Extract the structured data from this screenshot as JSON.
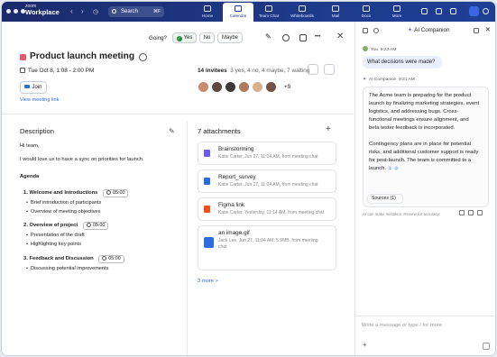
{
  "topbar": {
    "brand_small": "zoom",
    "brand_big": "Workplace",
    "search_label": "Search",
    "search_shortcut": "⌘F",
    "tabs": [
      {
        "label": "Home",
        "icon": "home-icon"
      },
      {
        "label": "Calendar",
        "icon": "calendar-icon",
        "active": true
      },
      {
        "label": "Team Chat",
        "icon": "chat-icon"
      },
      {
        "label": "Whiteboards",
        "icon": "whiteboard-icon"
      },
      {
        "label": "Mail",
        "icon": "mail-icon"
      },
      {
        "label": "Docs",
        "icon": "docs-icon"
      },
      {
        "label": "More",
        "icon": "more-icon"
      }
    ]
  },
  "event": {
    "going_label": "Going?",
    "yes_label": "Yes",
    "no_label": "No",
    "maybe_label": "Maybe",
    "more_label": "•••",
    "title": "Product launch meeting",
    "title_color": "#e25b6a",
    "when": "Tue Oct 8, 1:08 - 2:00 PM",
    "join_label": "Join",
    "view_link": "View meeting link",
    "invitees_count": "14 invitees",
    "invitees_breakdown": "3 yes, 4 no, 4 maybe, 7 waiting",
    "invitees_more": "+9"
  },
  "description": {
    "heading": "Description",
    "greeting": "Hi team,",
    "intro": "I would love us to have a sync on priorities for launch.",
    "agenda_label": "Agenda",
    "items": [
      {
        "title": "1. Welcome and Introductions",
        "time": "05:00",
        "bullets": [
          "Brief introduction of participants",
          "Overview of meeting objectives"
        ]
      },
      {
        "title": "2. Overview of project",
        "time": "05:00",
        "bullets": [
          "Presentation of the draft",
          "Highlighting key points"
        ]
      },
      {
        "title": "3. Feedback and Discussion",
        "time": "05:00",
        "bullets": [
          "Discussing potential improvements"
        ]
      }
    ]
  },
  "attachments": {
    "heading": "7 attachments",
    "items": [
      {
        "name": "Brainstorming",
        "meta": "Katie Carter, Jun 27, 11:04 AM, from meeting chat",
        "meta2": "",
        "color": "#6c5ce7"
      },
      {
        "name": "Report_survey",
        "meta": "Katie Carter, Jun 27, 11:04 AM, from meeting chat",
        "meta2": "",
        "color": "#2d6be0"
      },
      {
        "name": "Figma link",
        "meta": "Katie Carter, Yesterday, 11:14 AM, from meeting chat",
        "meta2": "",
        "color": "#f24e1e"
      },
      {
        "name": "an image.gif",
        "meta": "Jack Lee, Jun 27, 11:04 AM, 5.9MB, from meeting",
        "meta2": "chat",
        "color": "#2d6be0"
      }
    ],
    "more_label": "3 more  >"
  },
  "ai": {
    "title": "AI Companion",
    "you_label": "You",
    "you_time": "9:23 AM",
    "question": "What decisions were made?",
    "ai_label": "AI Companion",
    "ai_time": "9:21 AM",
    "answer_lines": [
      "The Acme team is preparing for the product",
      "launch by finalizing marketing strategies, event",
      "logistics, and addressing bugs. Cross-",
      "functional meetings ensure alignment, and",
      "beta tester feedback is incorporated."
    ],
    "answer2_lines": [
      "Contingency plans are in place for potential",
      "risks, and additional customer support is ready",
      "for post-launch. The team is committed to a",
      "launch."
    ],
    "ref1": "1",
    "ref2": "2",
    "sources": "Sources (1)",
    "disclaimer": "AI can make mistakes. Review for accuracy.",
    "input_placeholder": "Write a message or type / for more",
    "accent": "#6b4de6"
  }
}
